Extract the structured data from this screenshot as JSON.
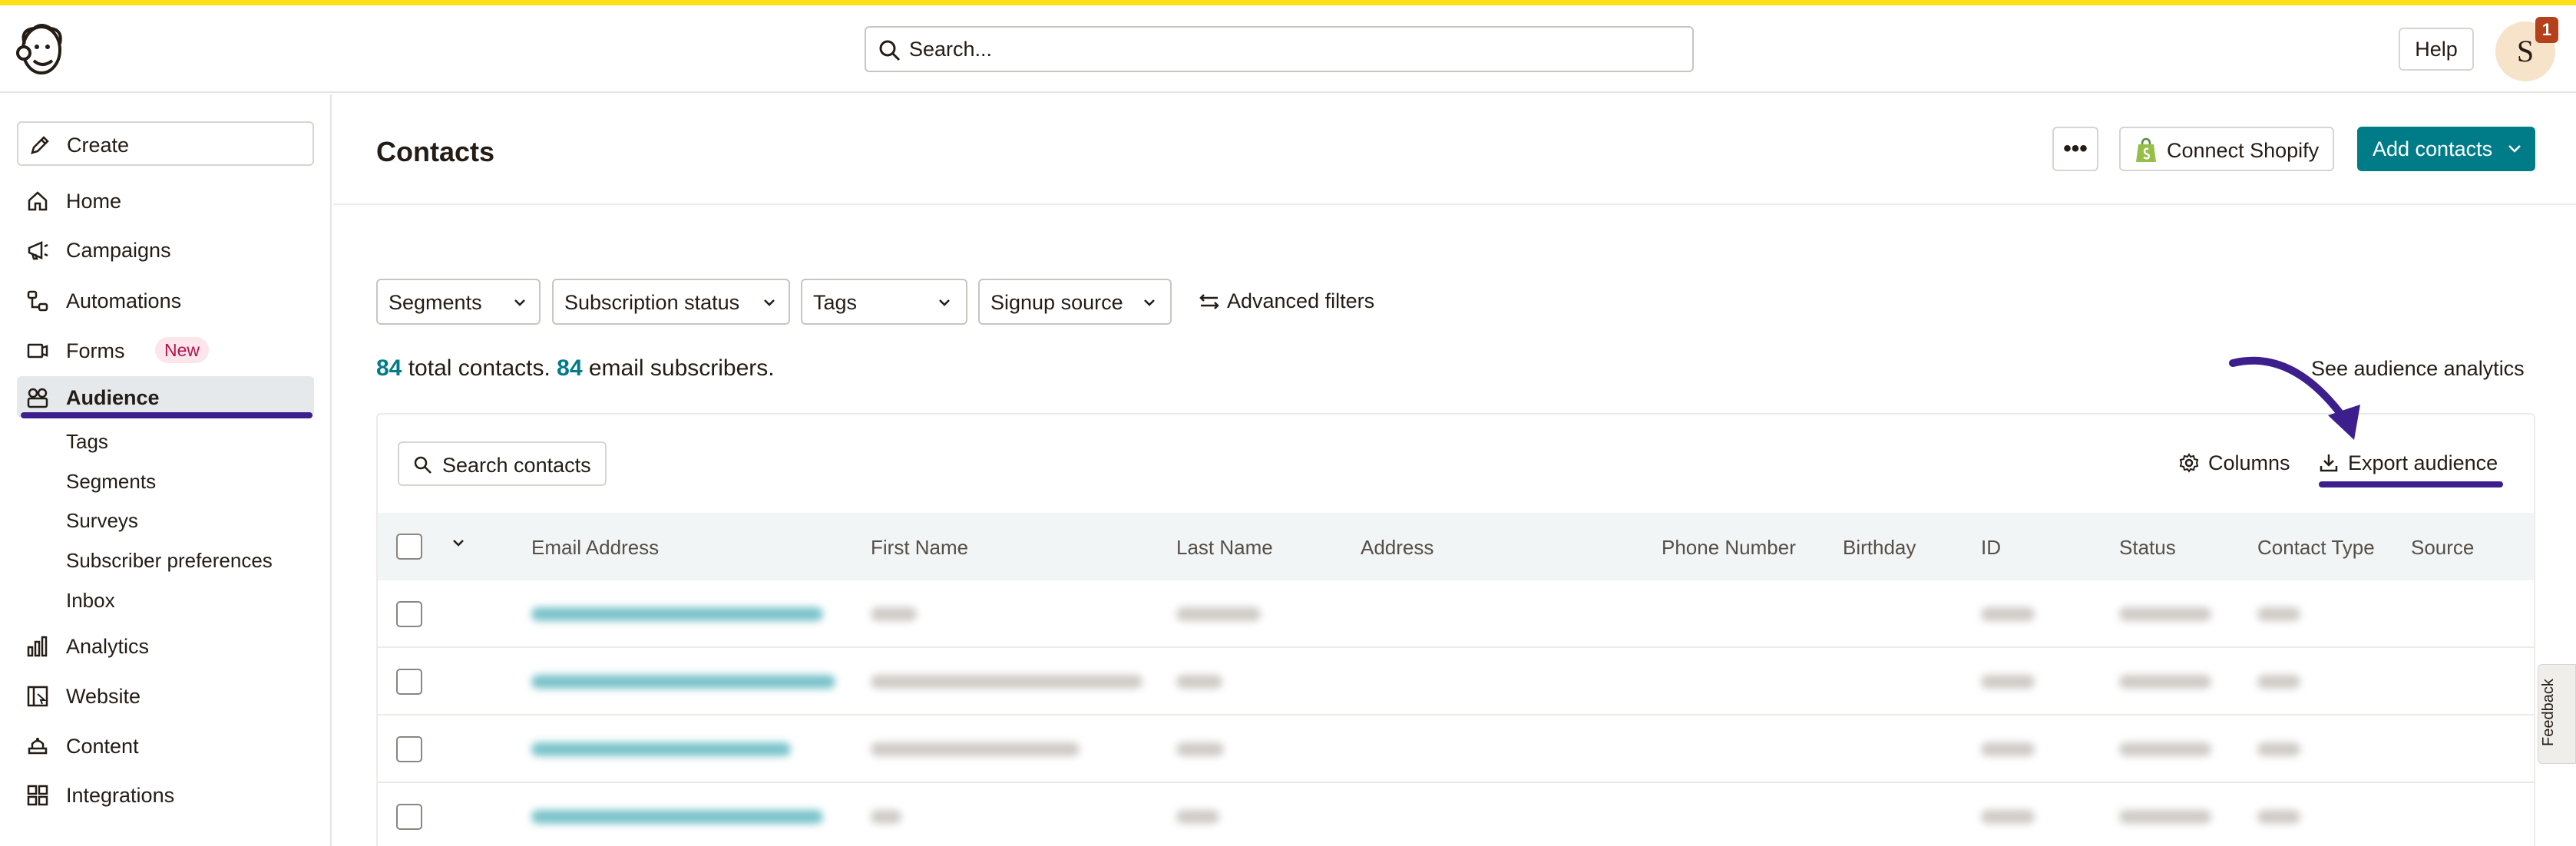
{
  "header": {
    "search_placeholder": "Search...",
    "help_label": "Help",
    "avatar_initial": "S",
    "notification_count": "1"
  },
  "sidebar": {
    "create_label": "Create",
    "items": [
      {
        "label": "Home",
        "icon": "home-icon"
      },
      {
        "label": "Campaigns",
        "icon": "megaphone-icon"
      },
      {
        "label": "Automations",
        "icon": "automation-icon"
      },
      {
        "label": "Forms",
        "icon": "form-icon",
        "badge": "New"
      },
      {
        "label": "Audience",
        "icon": "audience-icon",
        "active": true
      },
      {
        "label": "Analytics",
        "icon": "bar-chart-icon"
      },
      {
        "label": "Website",
        "icon": "website-icon"
      },
      {
        "label": "Content",
        "icon": "content-icon"
      },
      {
        "label": "Integrations",
        "icon": "grid-icon"
      }
    ],
    "audience_sub_items": [
      "Tags",
      "Segments",
      "Surveys",
      "Subscriber preferences",
      "Inbox"
    ]
  },
  "main": {
    "title": "Contacts",
    "more_label": "•••",
    "connect_shopify_label": "Connect Shopify",
    "add_contacts_label": "Add contacts",
    "filters": [
      "Segments",
      "Subscription status",
      "Tags",
      "Signup source"
    ],
    "advanced_filters_label": "Advanced filters",
    "counts": {
      "total": "84",
      "total_text": " total contacts. ",
      "subscribers": "84",
      "subscribers_text": " email subscribers."
    },
    "see_analytics_label": "See audience analytics",
    "search_contacts_label": "Search contacts",
    "columns_label": "Columns",
    "export_label": "Export audience",
    "table": {
      "headers": [
        "Email Address",
        "First Name",
        "Last Name",
        "Address",
        "Phone Number",
        "Birthday",
        "ID",
        "Status",
        "Contact Type",
        "Source"
      ]
    }
  },
  "feedback_label": "Feedback",
  "colors": {
    "brand_yellow": "#ffe01b",
    "accent_teal": "#007c89",
    "annotation_purple": "#3c1f8c"
  }
}
